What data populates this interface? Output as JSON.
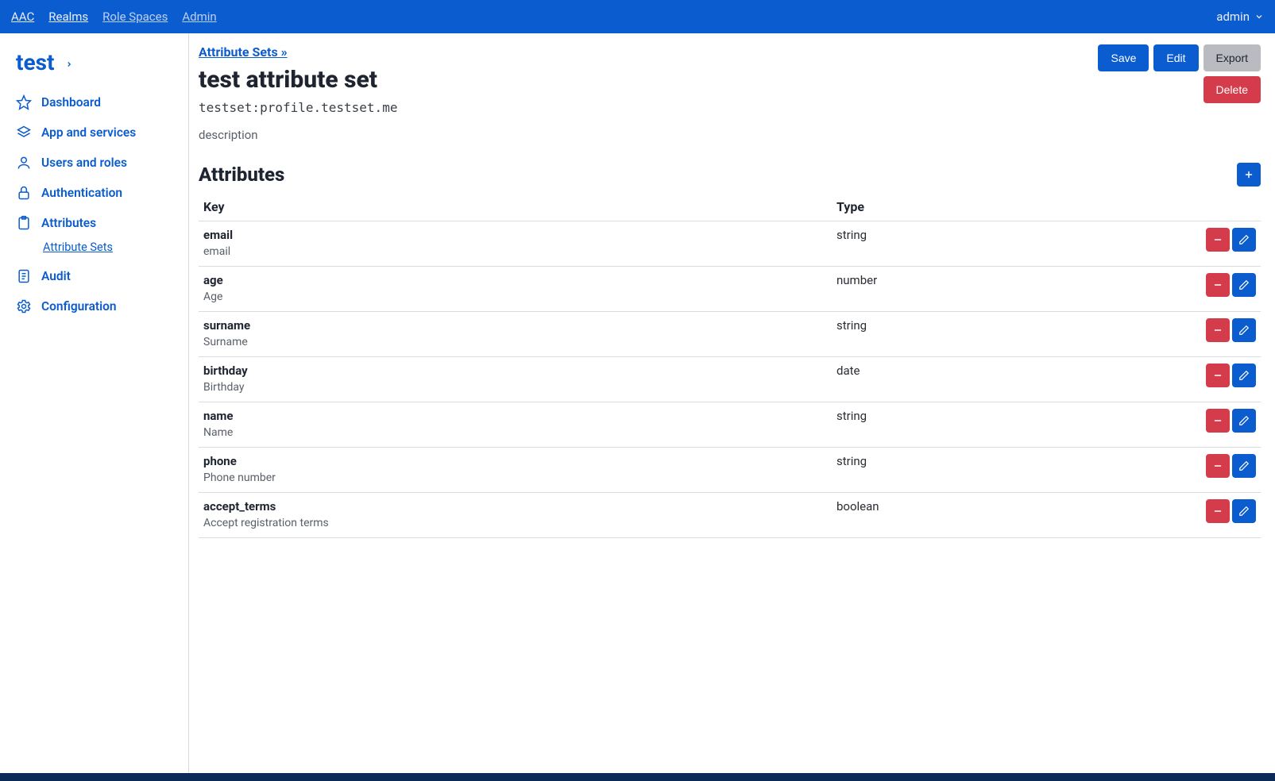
{
  "topbar": {
    "links": [
      {
        "label": "AAC",
        "muted": false
      },
      {
        "label": "Realms",
        "muted": false
      },
      {
        "label": "Role Spaces",
        "muted": true
      },
      {
        "label": "Admin",
        "muted": true
      }
    ],
    "user": "admin"
  },
  "sidebar": {
    "realm": "test",
    "items": [
      {
        "label": "Dashboard",
        "icon": "star"
      },
      {
        "label": "App and services",
        "icon": "layers"
      },
      {
        "label": "Users and roles",
        "icon": "user"
      },
      {
        "label": "Authentication",
        "icon": "lock"
      },
      {
        "label": "Attributes",
        "icon": "clipboard",
        "sub": {
          "label": "Attribute Sets"
        }
      },
      {
        "label": "Audit",
        "icon": "file"
      },
      {
        "label": "Configuration",
        "icon": "gear"
      }
    ]
  },
  "breadcrumb": "Attribute Sets »",
  "title": "test attribute set",
  "identifier": "testset:profile.testset.me",
  "description": "description",
  "buttons": {
    "save": "Save",
    "edit": "Edit",
    "export": "Export",
    "delete": "Delete"
  },
  "section_title": "Attributes",
  "table": {
    "headers": {
      "key": "Key",
      "type": "Type"
    },
    "rows": [
      {
        "key": "email",
        "desc": "email",
        "type": "string"
      },
      {
        "key": "age",
        "desc": "Age",
        "type": "number"
      },
      {
        "key": "surname",
        "desc": "Surname",
        "type": "string"
      },
      {
        "key": "birthday",
        "desc": "Birthday",
        "type": "date"
      },
      {
        "key": "name",
        "desc": "Name",
        "type": "string"
      },
      {
        "key": "phone",
        "desc": "Phone number",
        "type": "string"
      },
      {
        "key": "accept_terms",
        "desc": "Accept registration terms",
        "type": "boolean"
      }
    ]
  }
}
